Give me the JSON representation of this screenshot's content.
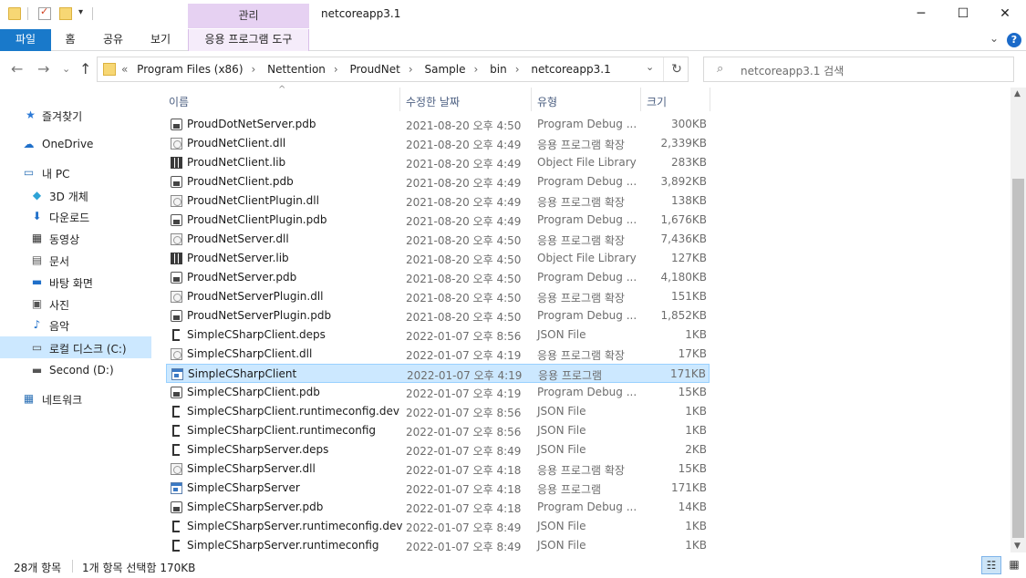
{
  "window": {
    "title": "netcoreapp3.1",
    "manage_tab": "관리",
    "minimize": "─",
    "maximize": "☐",
    "close": "✕"
  },
  "ribbon": {
    "tabs": [
      "파일",
      "홈",
      "공유",
      "보기"
    ],
    "manage_tools": "응용 프로그램 도구",
    "expand": "⌄",
    "help": "?"
  },
  "address": {
    "overflow": "«",
    "crumbs": [
      "Program Files (x86)",
      "Nettention",
      "ProudNet",
      "Sample",
      "bin",
      "netcoreapp3.1"
    ],
    "separator": "›",
    "dropdown": "⌄",
    "refresh": "↻"
  },
  "nav_buttons": {
    "back": "←",
    "forward": "→",
    "recent": "⌄",
    "up": "↑"
  },
  "search": {
    "placeholder": "netcoreapp3.1 검색",
    "icon": "⌕"
  },
  "nav_pane": [
    {
      "label": "즐겨찾기",
      "icon": "star-icon",
      "glyph": "★",
      "color": "#2b79d6"
    },
    {
      "label": "OneDrive",
      "icon": "cloud-icon",
      "glyph": "☁",
      "color": "#1f6fc9"
    },
    {
      "label": "내 PC",
      "icon": "computer-icon",
      "glyph": "▭",
      "color": "#2a6fb5"
    },
    {
      "label": "3D 개체",
      "icon": "cube-icon",
      "glyph": "◆",
      "color": "#2ea3d6"
    },
    {
      "label": "다운로드",
      "icon": "download-icon",
      "glyph": "⬇",
      "color": "#1f6fc9"
    },
    {
      "label": "동영상",
      "icon": "video-icon",
      "glyph": "▦",
      "color": "#333"
    },
    {
      "label": "문서",
      "icon": "document-icon",
      "glyph": "▤",
      "color": "#555"
    },
    {
      "label": "바탕 화면",
      "icon": "desktop-icon",
      "glyph": "▬",
      "color": "#1f6fc9"
    },
    {
      "label": "사진",
      "icon": "picture-icon",
      "glyph": "▣",
      "color": "#555"
    },
    {
      "label": "음악",
      "icon": "music-icon",
      "glyph": "♪",
      "color": "#1f6fc9"
    },
    {
      "label": "로컬 디스크 (C:)",
      "icon": "drive-icon",
      "glyph": "▭",
      "color": "#555"
    },
    {
      "label": "Second (D:)",
      "icon": "drive-icon",
      "glyph": "▬",
      "color": "#555"
    },
    {
      "label": "네트워크",
      "icon": "network-icon",
      "glyph": "▦",
      "color": "#2a6fb5"
    }
  ],
  "columns": {
    "name": "이름",
    "date": "수정한 날짜",
    "type": "유형",
    "size": "크기",
    "sort": "^"
  },
  "files": [
    {
      "name": "ProudDotNetServer.pdb",
      "date": "2021-08-20 오후 4:50",
      "type": "Program Debug ...",
      "size": "300KB",
      "kind": "pdb"
    },
    {
      "name": "ProudNetClient.dll",
      "date": "2021-08-20 오후 4:49",
      "type": "응용 프로그램 확장",
      "size": "2,339KB",
      "kind": "dll"
    },
    {
      "name": "ProudNetClient.lib",
      "date": "2021-08-20 오후 4:49",
      "type": "Object File Library",
      "size": "283KB",
      "kind": "lib"
    },
    {
      "name": "ProudNetClient.pdb",
      "date": "2021-08-20 오후 4:49",
      "type": "Program Debug ...",
      "size": "3,892KB",
      "kind": "pdb"
    },
    {
      "name": "ProudNetClientPlugin.dll",
      "date": "2021-08-20 오후 4:49",
      "type": "응용 프로그램 확장",
      "size": "138KB",
      "kind": "dll"
    },
    {
      "name": "ProudNetClientPlugin.pdb",
      "date": "2021-08-20 오후 4:49",
      "type": "Program Debug ...",
      "size": "1,676KB",
      "kind": "pdb"
    },
    {
      "name": "ProudNetServer.dll",
      "date": "2021-08-20 오후 4:50",
      "type": "응용 프로그램 확장",
      "size": "7,436KB",
      "kind": "dll"
    },
    {
      "name": "ProudNetServer.lib",
      "date": "2021-08-20 오후 4:50",
      "type": "Object File Library",
      "size": "127KB",
      "kind": "lib"
    },
    {
      "name": "ProudNetServer.pdb",
      "date": "2021-08-20 오후 4:50",
      "type": "Program Debug ...",
      "size": "4,180KB",
      "kind": "pdb"
    },
    {
      "name": "ProudNetServerPlugin.dll",
      "date": "2021-08-20 오후 4:50",
      "type": "응용 프로그램 확장",
      "size": "151KB",
      "kind": "dll"
    },
    {
      "name": "ProudNetServerPlugin.pdb",
      "date": "2021-08-20 오후 4:50",
      "type": "Program Debug ...",
      "size": "1,852KB",
      "kind": "pdb"
    },
    {
      "name": "SimpleCSharpClient.deps",
      "date": "2022-01-07 오후 8:56",
      "type": "JSON File",
      "size": "1KB",
      "kind": "json"
    },
    {
      "name": "SimpleCSharpClient.dll",
      "date": "2022-01-07 오후 4:19",
      "type": "응용 프로그램 확장",
      "size": "17KB",
      "kind": "dll"
    },
    {
      "name": "SimpleCSharpClient",
      "date": "2022-01-07 오후 4:19",
      "type": "응용 프로그램",
      "size": "171KB",
      "kind": "exe",
      "selected": true
    },
    {
      "name": "SimpleCSharpClient.pdb",
      "date": "2022-01-07 오후 4:19",
      "type": "Program Debug ...",
      "size": "15KB",
      "kind": "pdb"
    },
    {
      "name": "SimpleCSharpClient.runtimeconfig.dev",
      "date": "2022-01-07 오후 8:56",
      "type": "JSON File",
      "size": "1KB",
      "kind": "json"
    },
    {
      "name": "SimpleCSharpClient.runtimeconfig",
      "date": "2022-01-07 오후 8:56",
      "type": "JSON File",
      "size": "1KB",
      "kind": "json"
    },
    {
      "name": "SimpleCSharpServer.deps",
      "date": "2022-01-07 오후 8:49",
      "type": "JSON File",
      "size": "2KB",
      "kind": "json"
    },
    {
      "name": "SimpleCSharpServer.dll",
      "date": "2022-01-07 오후 4:18",
      "type": "응용 프로그램 확장",
      "size": "15KB",
      "kind": "dll"
    },
    {
      "name": "SimpleCSharpServer",
      "date": "2022-01-07 오후 4:18",
      "type": "응용 프로그램",
      "size": "171KB",
      "kind": "exe"
    },
    {
      "name": "SimpleCSharpServer.pdb",
      "date": "2022-01-07 오후 4:18",
      "type": "Program Debug ...",
      "size": "14KB",
      "kind": "pdb"
    },
    {
      "name": "SimpleCSharpServer.runtimeconfig.dev",
      "date": "2022-01-07 오후 8:49",
      "type": "JSON File",
      "size": "1KB",
      "kind": "json"
    },
    {
      "name": "SimpleCSharpServer.runtimeconfig",
      "date": "2022-01-07 오후 8:49",
      "type": "JSON File",
      "size": "1KB",
      "kind": "json"
    }
  ],
  "status": {
    "item_count": "28개 항목",
    "selection": "1개 항목 선택함 170KB",
    "view_details": "☷",
    "view_tiles": "▦"
  }
}
